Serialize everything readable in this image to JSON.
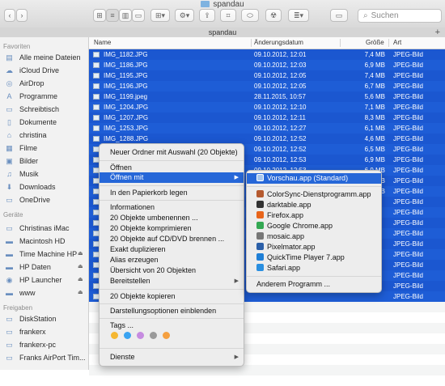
{
  "window": {
    "title": "spandau"
  },
  "toolbar": {
    "search_placeholder": "Suchen",
    "back": "‹",
    "forward": "›"
  },
  "tabbar": {
    "path": "spandau",
    "add": "+"
  },
  "sidebar": {
    "favorites_label": "Favoriten",
    "favorites": [
      {
        "label": "Alle meine Dateien",
        "icon": "all-files-icon",
        "glyph": "▤"
      },
      {
        "label": "iCloud Drive",
        "icon": "cloud-icon",
        "glyph": "☁"
      },
      {
        "label": "AirDrop",
        "icon": "airdrop-icon",
        "glyph": "◎"
      },
      {
        "label": "Programme",
        "icon": "applications-icon",
        "glyph": "A"
      },
      {
        "label": "Schreibtisch",
        "icon": "desktop-icon",
        "glyph": "▭"
      },
      {
        "label": "Dokumente",
        "icon": "documents-icon",
        "glyph": "▯"
      },
      {
        "label": "christina",
        "icon": "home-icon",
        "glyph": "⌂"
      },
      {
        "label": "Filme",
        "icon": "movies-icon",
        "glyph": "▦"
      },
      {
        "label": "Bilder",
        "icon": "pictures-icon",
        "glyph": "▣"
      },
      {
        "label": "Musik",
        "icon": "music-icon",
        "glyph": "♫"
      },
      {
        "label": "Downloads",
        "icon": "downloads-icon",
        "glyph": "⬇"
      },
      {
        "label": "OneDrive",
        "icon": "folder-icon",
        "glyph": "▭"
      }
    ],
    "devices_label": "Geräte",
    "devices": [
      {
        "label": "Christinas iMac",
        "icon": "imac-icon",
        "glyph": "▭",
        "eject": ""
      },
      {
        "label": "Macintosh HD",
        "icon": "disk-icon",
        "glyph": "▬",
        "eject": ""
      },
      {
        "label": "Time Machine HP",
        "icon": "disk-icon",
        "glyph": "▬",
        "eject": "⏏"
      },
      {
        "label": "HP Daten",
        "icon": "disk-icon",
        "glyph": "▬",
        "eject": "⏏"
      },
      {
        "label": "HP Launcher",
        "icon": "cd-icon",
        "glyph": "◉",
        "eject": "⏏"
      },
      {
        "label": "www",
        "icon": "network-drive-icon",
        "glyph": "▬",
        "eject": "⏏"
      }
    ],
    "shared_label": "Freigaben",
    "shared": [
      {
        "label": "DiskStation",
        "icon": "server-icon",
        "glyph": "▭"
      },
      {
        "label": "frankerx",
        "icon": "display-icon",
        "glyph": "▭"
      },
      {
        "label": "frankerx-pc",
        "icon": "pc-icon",
        "glyph": "▭"
      },
      {
        "label": "Franks AirPort Tim...",
        "icon": "airport-icon",
        "glyph": "▭"
      }
    ]
  },
  "columns": {
    "name": "Name",
    "date": "Änderungsdatum",
    "size": "Größe",
    "kind": "Art"
  },
  "files": [
    {
      "name": "IMG_1182.JPG",
      "date": "09.10.2012, 12:01",
      "size": "7,4 MB",
      "kind": "JPEG-Bild"
    },
    {
      "name": "IMG_1186.JPG",
      "date": "09.10.2012, 12:03",
      "size": "6,9 MB",
      "kind": "JPEG-Bild"
    },
    {
      "name": "IMG_1195.JPG",
      "date": "09.10.2012, 12:05",
      "size": "7,4 MB",
      "kind": "JPEG-Bild"
    },
    {
      "name": "IMG_1196.JPG",
      "date": "09.10.2012, 12:05",
      "size": "6,7 MB",
      "kind": "JPEG-Bild"
    },
    {
      "name": "IMG_1199.jpeg",
      "date": "28.11.2015, 10:57",
      "size": "5,6 MB",
      "kind": "JPEG-Bild"
    },
    {
      "name": "IMG_1204.JPG",
      "date": "09.10.2012, 12:10",
      "size": "7,1 MB",
      "kind": "JPEG-Bild"
    },
    {
      "name": "IMG_1207.JPG",
      "date": "09.10.2012, 12:11",
      "size": "8,3 MB",
      "kind": "JPEG-Bild"
    },
    {
      "name": "IMG_1253.JPG",
      "date": "09.10.2012, 12:27",
      "size": "6,1 MB",
      "kind": "JPEG-Bild"
    },
    {
      "name": "IMG_1288.JPG",
      "date": "09.10.2012, 12:52",
      "size": "4,6 MB",
      "kind": "JPEG-Bild"
    },
    {
      "name": "IMG_1289.JPG",
      "date": "09.10.2012, 12:52",
      "size": "6,5 MB",
      "kind": "JPEG-Bild"
    },
    {
      "name": "",
      "date": "09.10.2012, 12:53",
      "size": "6,9 MB",
      "kind": "JPEG-Bild"
    },
    {
      "name": "",
      "date": "09.10.2012, 12:53",
      "size": "6,9 MB",
      "kind": "JPEG-Bild"
    },
    {
      "name": "",
      "date": "09.10.2012, 13:02",
      "size": "3,5 MB",
      "kind": "JPEG-Bild"
    },
    {
      "name": "",
      "date": "09.10.2012, 13:03",
      "size": "7,1 MB",
      "kind": "JPEG-Bild"
    },
    {
      "name": "",
      "date": "",
      "size": "",
      "kind": "JPEG-Bild"
    },
    {
      "name": "",
      "date": "",
      "size": "",
      "kind": "JPEG-Bild"
    },
    {
      "name": "",
      "date": "",
      "size": "",
      "kind": "JPEG-Bild"
    },
    {
      "name": "",
      "date": "",
      "size": "",
      "kind": "JPEG-Bild"
    },
    {
      "name": "",
      "date": "",
      "size": "",
      "kind": "JPEG-Bild"
    },
    {
      "name": "",
      "date": "",
      "size": "",
      "kind": "JPEG-Bild"
    },
    {
      "name": "",
      "date": "",
      "size": "",
      "kind": "JPEG-Bild"
    },
    {
      "name": "",
      "date": "",
      "size": "",
      "kind": "JPEG-Bild"
    },
    {
      "name": "",
      "date": "",
      "size": "",
      "kind": "JPEG-Bild"
    },
    {
      "name": "",
      "date": "",
      "size": "",
      "kind": "JPEG-Bild"
    }
  ],
  "context_menu": {
    "items": [
      "Neuer Ordner mit Auswahl (20 Objekte)",
      "Öffnen",
      "Öffnen mit",
      "In den Papierkorb legen",
      "Informationen",
      "20 Objekte umbenennen ...",
      "20 Objekte komprimieren",
      "20 Objekte auf CD/DVD brennen ...",
      "Exakt duplizieren",
      "Alias erzeugen",
      "Übersicht von 20 Objekten",
      "Bereitstellen",
      "20 Objekte kopieren",
      "Darstellungsoptionen einblenden",
      "Tags ...",
      "Dienste"
    ],
    "tag_colors": [
      "#f5b731",
      "#3aa3f1",
      "#c68be0",
      "#9a9a9a",
      "#f5a040"
    ]
  },
  "open_with_menu": {
    "default": "Vorschau.app (Standard)",
    "apps": [
      {
        "label": "ColorSync-Dienstprogramm.app",
        "icon": "colorsync-icon",
        "color": "#b55a2f"
      },
      {
        "label": "darktable.app",
        "icon": "darktable-icon",
        "color": "#333333"
      },
      {
        "label": "Firefox.app",
        "icon": "firefox-icon",
        "color": "#e8651b"
      },
      {
        "label": "Google Chrome.app",
        "icon": "chrome-icon",
        "color": "#34a853"
      },
      {
        "label": "mosaic.app",
        "icon": "mosaic-icon",
        "color": "#777777"
      },
      {
        "label": "Pixelmator.app",
        "icon": "pixelmator-icon",
        "color": "#2b5fa8"
      },
      {
        "label": "QuickTime Player 7.app",
        "icon": "quicktime-icon",
        "color": "#1f7fd6"
      },
      {
        "label": "Safari.app",
        "icon": "safari-icon",
        "color": "#2a8fe0"
      }
    ],
    "other": "Anderem Programm ..."
  }
}
